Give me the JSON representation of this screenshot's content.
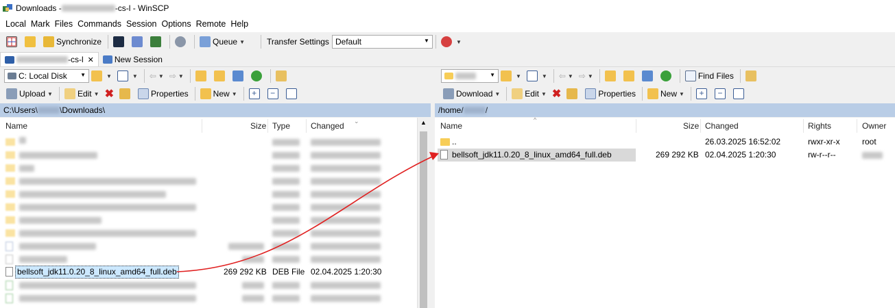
{
  "window": {
    "title_prefix": "Downloads - ",
    "title_suffix": "-cs-l - WinSCP"
  },
  "menu": [
    "Local",
    "Mark",
    "Files",
    "Commands",
    "Session",
    "Options",
    "Remote",
    "Help"
  ],
  "toolbar": {
    "synchronize": "Synchronize",
    "queue": "Queue",
    "transfer_settings_label": "Transfer Settings",
    "transfer_settings_value": "Default"
  },
  "tabs": {
    "session_suffix": "-cs-l",
    "close": "✕",
    "new_session": "New Session"
  },
  "local": {
    "drive": "C: Local Disk",
    "upload": "Upload",
    "edit": "Edit",
    "properties": "Properties",
    "new": "New",
    "path_prefix": "C:\\Users\\",
    "path_suffix": "\\Downloads\\",
    "columns": {
      "name": "Name",
      "size": "Size",
      "type": "Type",
      "changed": "Changed"
    },
    "file": {
      "name": "bellsoft_jdk11.0.20_8_linux_amd64_full.deb",
      "size": "269 292 KB",
      "type": "DEB File",
      "changed": "02.04.2025  1:20:30"
    }
  },
  "remote": {
    "download": "Download",
    "edit": "Edit",
    "properties": "Properties",
    "new": "New",
    "find_files": "Find Files",
    "path_prefix": "/home/",
    "path_suffix": "/",
    "columns": {
      "name": "Name",
      "size": "Size",
      "changed": "Changed",
      "rights": "Rights",
      "owner": "Owner"
    },
    "parent": {
      "name": "..",
      "changed": "26.03.2025 16:52:02",
      "rights": "rwxr-xr-x",
      "owner": "root"
    },
    "file": {
      "name": "bellsoft_jdk11.0.20_8_linux_amd64_full.deb",
      "size": "269 292 KB",
      "changed": "02.04.2025 1:20:30",
      "rights": "rw-r--r--"
    }
  },
  "colors": {
    "accent_path": "#b9cde6",
    "selection": "#cce8ff",
    "arrow": "#e02020",
    "folder": "#f7cd57"
  }
}
